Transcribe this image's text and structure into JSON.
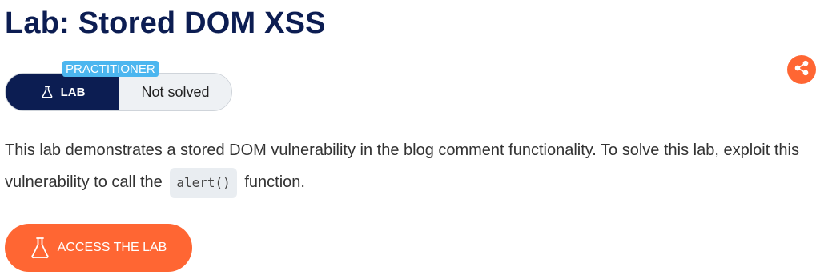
{
  "page": {
    "title": "Lab: Stored DOM XSS"
  },
  "lab_status": {
    "level": "PRACTITIONER",
    "lab_label": "LAB",
    "status": "Not solved"
  },
  "description": {
    "text_before_code": "This lab demonstrates a stored DOM vulnerability in the blog comment functionality. To solve this lab, exploit this vulnerability to call the",
    "code": "alert()",
    "text_after_code": "function."
  },
  "actions": {
    "access_lab_label": "ACCESS THE LAB"
  },
  "icons": {
    "lab": "flask-icon",
    "share": "share-icon",
    "access": "flask-icon"
  },
  "colors": {
    "navy": "#0c1d52",
    "accent": "#ff6633",
    "badge": "#4cb6ef"
  }
}
